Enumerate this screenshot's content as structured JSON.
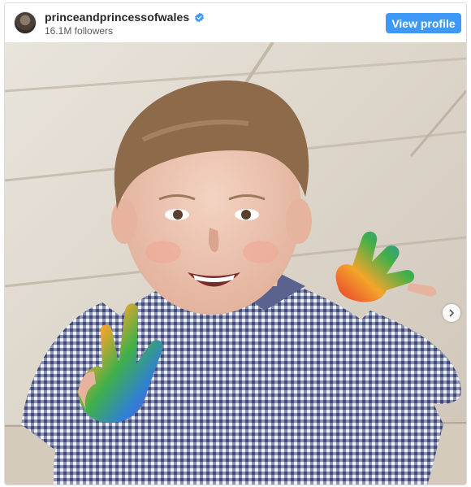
{
  "post": {
    "username": "princeandprincessofwales",
    "followers": "16.1M followers",
    "view_profile_label": "View profile",
    "verified": true
  },
  "icons": {
    "verified": "verified-badge-icon",
    "next": "chevron-right-icon"
  },
  "colors": {
    "button": "#3d99f5",
    "verified_badge": "#3d99f5",
    "username": "#262626"
  }
}
